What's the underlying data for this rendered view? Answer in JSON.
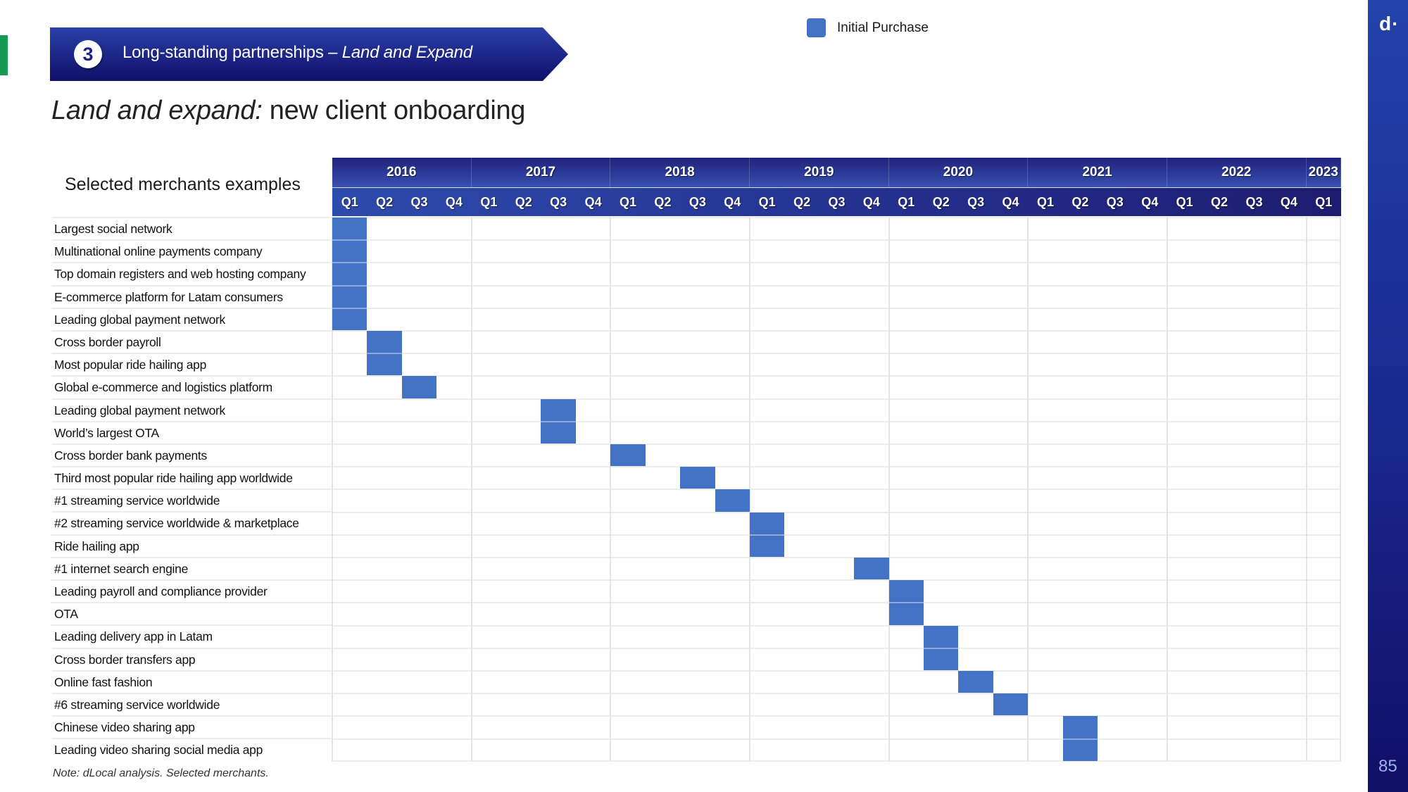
{
  "slide": {
    "section_number": "3",
    "section_title_regular": "Long-standing partnerships – ",
    "section_title_italic": "Land and Expand",
    "title_italic": "Land and expand:",
    "title_regular": " new client onboarding",
    "brand_logo": "d·",
    "page_number": "85",
    "footnote": "Note:  dLocal analysis. Selected merchants.",
    "colors": {
      "bar": "#4472c4",
      "header_navy": "#23237a",
      "accent_green": "#169a52",
      "side_bar_blue": "#1b2c95"
    }
  },
  "chart_data": {
    "type": "table",
    "title": "Land and expand: new client onboarding",
    "row_heading": "Selected merchants examples",
    "legend": [
      {
        "label": "Initial Purchase",
        "color": "#4472c4",
        "icon": "square-swatch"
      }
    ],
    "legend_position": "top-right",
    "years": [
      {
        "label": "2016",
        "quarters": 4
      },
      {
        "label": "2017",
        "quarters": 4
      },
      {
        "label": "2018",
        "quarters": 4
      },
      {
        "label": "2019",
        "quarters": 4
      },
      {
        "label": "2020",
        "quarters": 4
      },
      {
        "label": "2021",
        "quarters": 4
      },
      {
        "label": "2022",
        "quarters": 4
      },
      {
        "label": "2023",
        "quarters": 1
      }
    ],
    "quarters": [
      "Q1",
      "Q2",
      "Q3",
      "Q4",
      "Q1",
      "Q2",
      "Q3",
      "Q4",
      "Q1",
      "Q2",
      "Q3",
      "Q4",
      "Q1",
      "Q2",
      "Q3",
      "Q4",
      "Q1",
      "Q2",
      "Q3",
      "Q4",
      "Q1",
      "Q2",
      "Q3",
      "Q4",
      "Q1",
      "Q2",
      "Q3",
      "Q4",
      "Q1"
    ],
    "merchants": [
      {
        "name": "Largest social network",
        "initial_purchase": "2016 Q1"
      },
      {
        "name": "Multinational online payments company",
        "initial_purchase": "2016 Q1"
      },
      {
        "name": "Top domain registers and web hosting company",
        "initial_purchase": "2016 Q1"
      },
      {
        "name": "E-commerce platform for Latam consumers",
        "initial_purchase": "2016 Q1"
      },
      {
        "name": "Leading global payment network",
        "initial_purchase": "2016 Q1"
      },
      {
        "name": "Cross border payroll",
        "initial_purchase": "2016 Q2"
      },
      {
        "name": "Most popular ride hailing app",
        "initial_purchase": "2016 Q2"
      },
      {
        "name": "Global e-commerce and logistics platform",
        "initial_purchase": "2016 Q3"
      },
      {
        "name": "Leading global payment network",
        "initial_purchase": "2017 Q3"
      },
      {
        "name": "World’s largest OTA",
        "initial_purchase": "2017 Q3"
      },
      {
        "name": "Cross border bank payments",
        "initial_purchase": "2018 Q1"
      },
      {
        "name": "Third most popular ride hailing app worldwide",
        "initial_purchase": "2018 Q3"
      },
      {
        "name": "#1 streaming service worldwide",
        "initial_purchase": "2018 Q4"
      },
      {
        "name": "#2 streaming service worldwide & marketplace",
        "initial_purchase": "2019 Q1"
      },
      {
        "name": "Ride hailing app",
        "initial_purchase": "2019 Q1"
      },
      {
        "name": "#1 internet search engine",
        "initial_purchase": "2019 Q4"
      },
      {
        "name": "Leading payroll and compliance provider",
        "initial_purchase": "2020 Q1"
      },
      {
        "name": "OTA",
        "initial_purchase": "2020 Q1"
      },
      {
        "name": "Leading delivery app in Latam",
        "initial_purchase": "2020 Q2"
      },
      {
        "name": "Cross border transfers app",
        "initial_purchase": "2020 Q2"
      },
      {
        "name": "Online fast fashion",
        "initial_purchase": "2020 Q3"
      },
      {
        "name": "#6 streaming service worldwide",
        "initial_purchase": "2020 Q4"
      },
      {
        "name": "Chinese video sharing app",
        "initial_purchase": "2021 Q2"
      },
      {
        "name": "Leading video sharing social media app",
        "initial_purchase": "2021 Q2"
      }
    ]
  }
}
